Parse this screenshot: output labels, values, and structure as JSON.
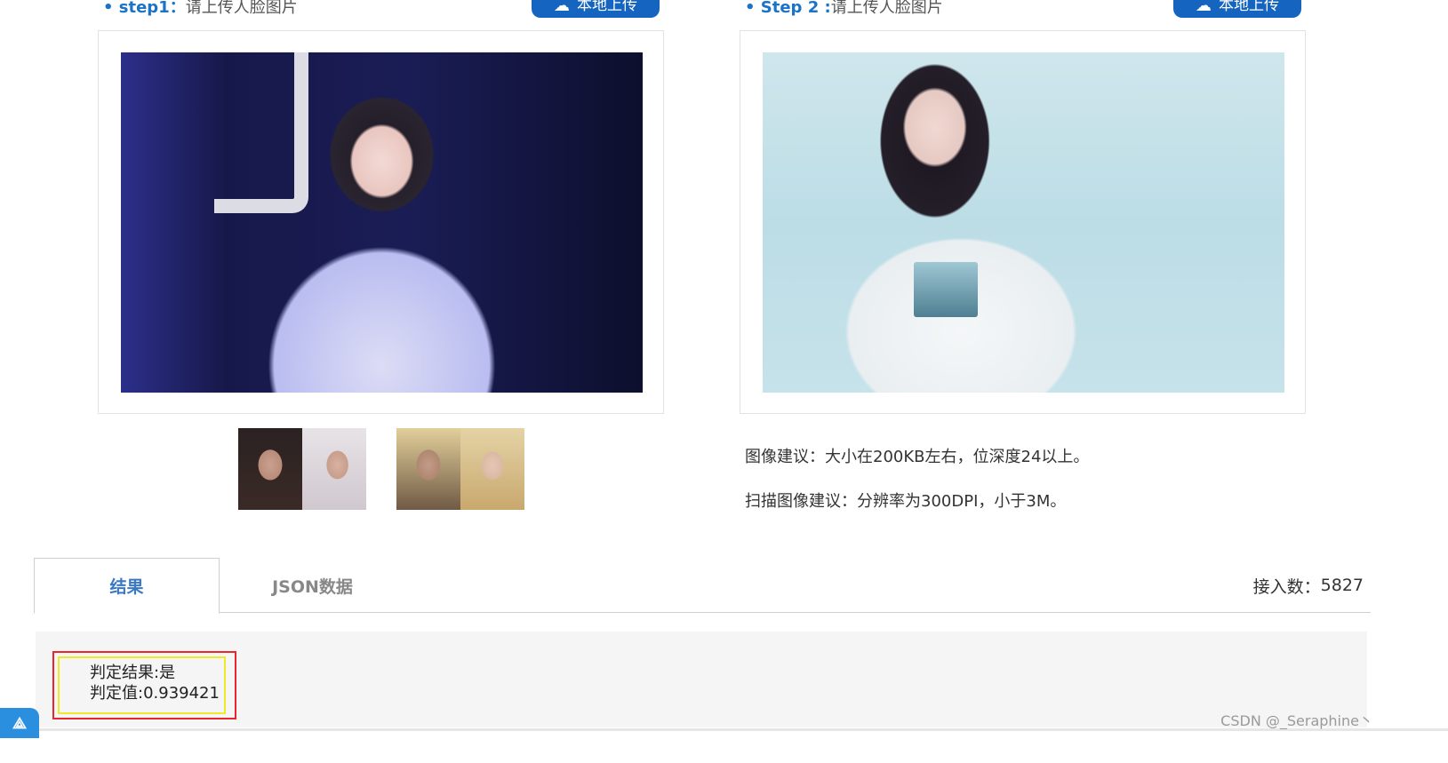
{
  "step1": {
    "title": "step1：",
    "desc": "请上传人脸图片",
    "upload_label": "本地上传"
  },
  "step2": {
    "title": "Step 2 :",
    "desc": "请上传人脸图片",
    "upload_label": "本地上传"
  },
  "hints": [
    "图像建议：大小在200KB左右，位深度24以上。",
    "扫描图像建议：分辨率为300DPI，小于3M。"
  ],
  "tabs": {
    "result": "结果",
    "json": "JSON数据"
  },
  "counter": {
    "label": "接入数：",
    "value": "5827"
  },
  "result": {
    "line1": "判定结果:是",
    "line2": "判定值:0.939421"
  },
  "watermark": "CSDN @_Seraphine丶",
  "icons": {
    "upload": "cloud-upload-icon",
    "corner": "app-logo-icon"
  },
  "colors": {
    "accent": "#1565c0",
    "tab_active": "#3b78c4",
    "highlight_red": "#e8262b",
    "highlight_yellow": "#eeea2a"
  }
}
